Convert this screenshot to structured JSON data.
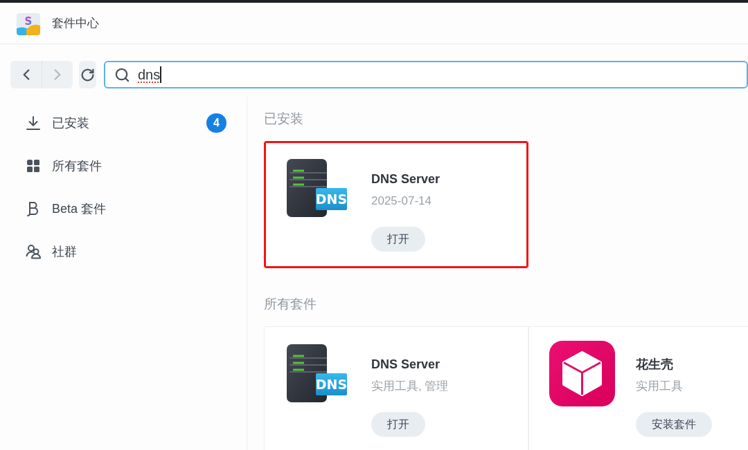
{
  "window": {
    "title": "套件中心",
    "icon_letter": "S"
  },
  "toolbar": {
    "history_buttons": [
      {
        "kind": "back",
        "disabled": false
      },
      {
        "kind": "forward",
        "disabled": true
      }
    ],
    "search": {
      "value": "dns",
      "focused": true,
      "misspelled": true
    }
  },
  "sidebar": {
    "items": [
      {
        "label": "已安装",
        "selected": false,
        "count": "4"
      },
      {
        "label": "所有套件",
        "selected": false
      },
      {
        "label": "Beta 套件",
        "selected": false
      },
      {
        "label": "社群",
        "selected": false
      }
    ]
  },
  "sections": [
    {
      "heading": "已安装",
      "packages": [
        {
          "kind": "server",
          "name": "DNS Server",
          "detail": "2025-07-14",
          "icon_label": "DNS",
          "action": "打开",
          "highlighted": true
        }
      ]
    },
    {
      "heading": "所有套件",
      "packages": [
        {
          "kind": "server",
          "name": "DNS Server",
          "detail": "实用工具, 管理",
          "icon_label": "DNS",
          "action": "打开",
          "highlighted": false
        },
        {
          "kind": "cube",
          "name": "花生壳",
          "detail": "实用工具",
          "action": "安装套件",
          "highlighted": false
        }
      ]
    }
  ]
}
